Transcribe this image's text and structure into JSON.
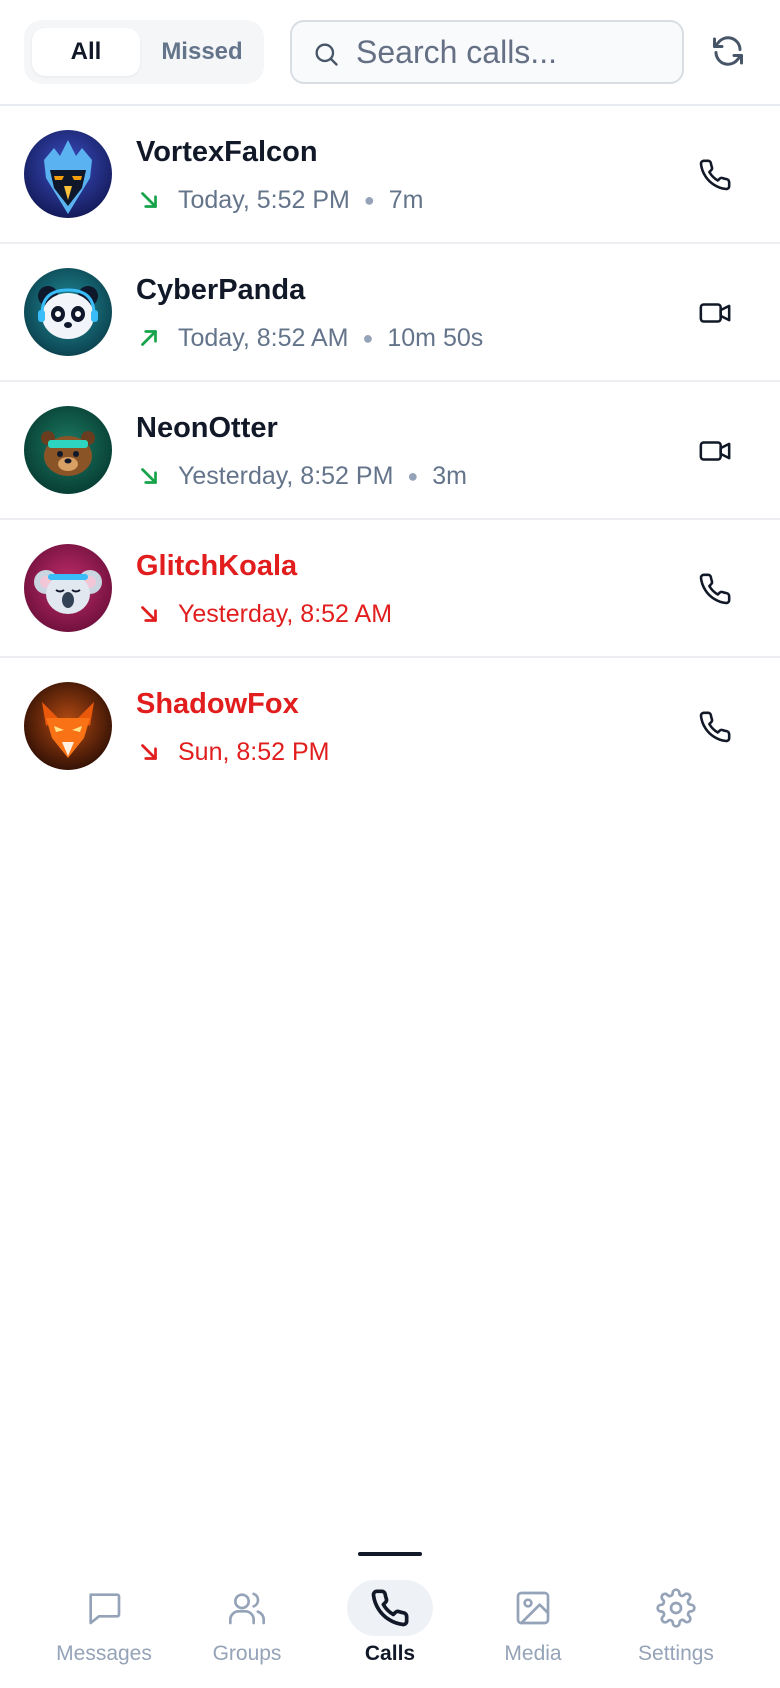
{
  "header": {
    "filter_tabs": [
      {
        "label": "All",
        "active": true
      },
      {
        "label": "Missed",
        "active": false
      }
    ],
    "search": {
      "placeholder": "Search calls...",
      "value": "",
      "icon": "search-icon"
    },
    "refresh_icon": "refresh-icon"
  },
  "calls": [
    {
      "name": "VortexFalcon",
      "direction": "incoming",
      "time": "Today, 5:52 PM",
      "duration": "7m",
      "missed": false,
      "call_type": "voice",
      "avatar": "falcon-avatar"
    },
    {
      "name": "CyberPanda",
      "direction": "outgoing",
      "time": "Today, 8:52 AM",
      "duration": "10m 50s",
      "missed": false,
      "call_type": "video",
      "avatar": "panda-avatar"
    },
    {
      "name": "NeonOtter",
      "direction": "incoming",
      "time": "Yesterday, 8:52 PM",
      "duration": "3m",
      "missed": false,
      "call_type": "video",
      "avatar": "otter-avatar"
    },
    {
      "name": "GlitchKoala",
      "direction": "missed",
      "time": "Yesterday, 8:52 AM",
      "duration": "",
      "missed": true,
      "call_type": "voice",
      "avatar": "koala-avatar"
    },
    {
      "name": "ShadowFox",
      "direction": "missed",
      "time": "Sun, 8:52 PM",
      "duration": "",
      "missed": true,
      "call_type": "voice",
      "avatar": "fox-avatar"
    }
  ],
  "nav": {
    "items": [
      {
        "label": "Messages",
        "icon": "message-icon",
        "active": false
      },
      {
        "label": "Groups",
        "icon": "users-icon",
        "active": false
      },
      {
        "label": "Calls",
        "icon": "phone-icon",
        "active": true
      },
      {
        "label": "Media",
        "icon": "image-icon",
        "active": false
      },
      {
        "label": "Settings",
        "icon": "gear-icon",
        "active": false
      }
    ]
  },
  "colors": {
    "incoming_arrow": "#16a34a",
    "outgoing_arrow": "#16a34a",
    "missed": "#e11d1d",
    "text_primary": "#111827",
    "text_secondary": "#64748b"
  }
}
